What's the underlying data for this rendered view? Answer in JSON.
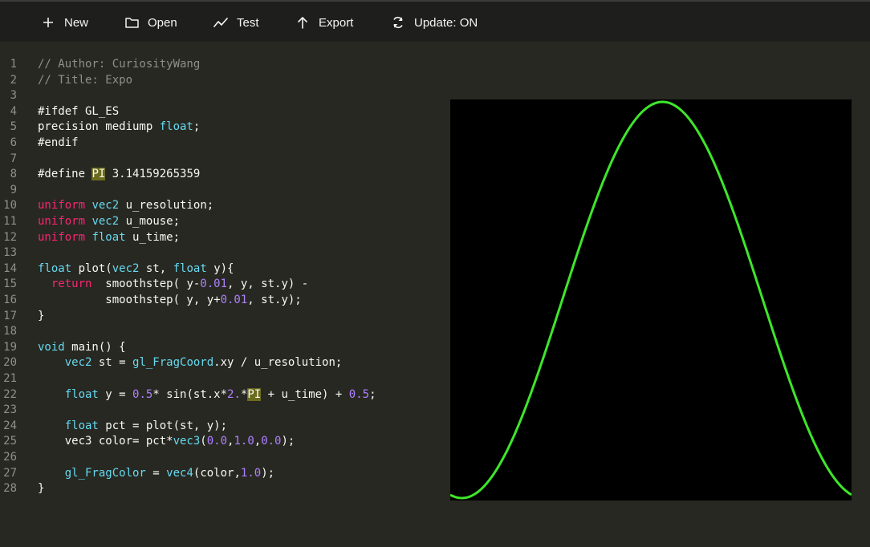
{
  "toolbar": {
    "new_label": "New",
    "open_label": "Open",
    "test_label": "Test",
    "export_label": "Export",
    "update_label": "Update: ON",
    "icons": [
      "plus-icon",
      "folder-icon",
      "chart-line-icon",
      "arrow-up-icon",
      "refresh-icon"
    ]
  },
  "editor": {
    "line_numbers": [
      "1",
      "2",
      "3",
      "4",
      "5",
      "6",
      "7",
      "8",
      "9",
      "10",
      "11",
      "12",
      "13",
      "14",
      "15",
      "16",
      "17",
      "18",
      "19",
      "20",
      "21",
      "22",
      "23",
      "24",
      "25",
      "26",
      "27",
      "28"
    ],
    "code": {
      "l1": "// Author: CuriosityWang",
      "l2": "// Title: Expo",
      "l4": "#ifdef GL_ES",
      "l5a": "precision mediump ",
      "l5b": "float",
      "l5c": ";",
      "l6": "#endif",
      "l8a": "#define ",
      "l8b": "PI",
      "l8c": " 3.14159265359",
      "l10a": "uniform",
      "l10b": " ",
      "l10c": "vec2",
      "l10d": " u_resolution;",
      "l11a": "uniform",
      "l11b": " ",
      "l11c": "vec2",
      "l11d": " u_mouse;",
      "l12a": "uniform",
      "l12b": " ",
      "l12c": "float",
      "l12d": " u_time;",
      "l14a": "float",
      "l14b": " plot(",
      "l14c": "vec2",
      "l14d": " st, ",
      "l14e": "float",
      "l14f": " y){",
      "l15a": "  ",
      "l15b": "return",
      "l15c": "  smoothstep( y-",
      "l15d": "0.01",
      "l15e": ", y, st.y) -",
      "l16a": "          smoothstep( y, y+",
      "l16b": "0.01",
      "l16c": ", st.y);",
      "l17": "}",
      "l19a": "void",
      "l19b": " main() {",
      "l20a": "    ",
      "l20b": "vec2",
      "l20c": " st = ",
      "l20d": "gl_FragCoord",
      "l20e": ".xy / u_resolution;",
      "l22a": "    ",
      "l22b": "float",
      "l22c": " y = ",
      "l22d": "0.5",
      "l22e": "* sin(st.x*",
      "l22f": "2.",
      "l22g": "*",
      "l22h": "PI",
      "l22i": " + u_time) + ",
      "l22j": "0.5",
      "l22k": ";",
      "l24a": "    ",
      "l24b": "float",
      "l24c": " pct = plot(st, y);",
      "l25a": "    vec3 color= pct*",
      "l25b": "vec3",
      "l25c": "(",
      "l25d": "0.0",
      "l25e": ",",
      "l25f": "1.0",
      "l25g": ",",
      "l25h": "0.0",
      "l25i": ");",
      "l27a": "    ",
      "l27b": "gl_FragColor",
      "l27c": " = ",
      "l27d": "vec4",
      "l27e": "(color,",
      "l27f": "1.0",
      "l27g": ");",
      "l28": "}"
    }
  },
  "preview": {
    "background": "#000000",
    "curve_color": "#3ee62a",
    "function": "y = 0.5*sin(x*2*PI + u_time) + 0.5"
  },
  "colors": {
    "editor_bg": "#272822",
    "menubar_bg": "#1e1e1c",
    "comment": "#8f908a",
    "keyword": "#f92672",
    "type": "#66d9ef",
    "number": "#ae81ff",
    "highlight": "#6b6b1e"
  }
}
